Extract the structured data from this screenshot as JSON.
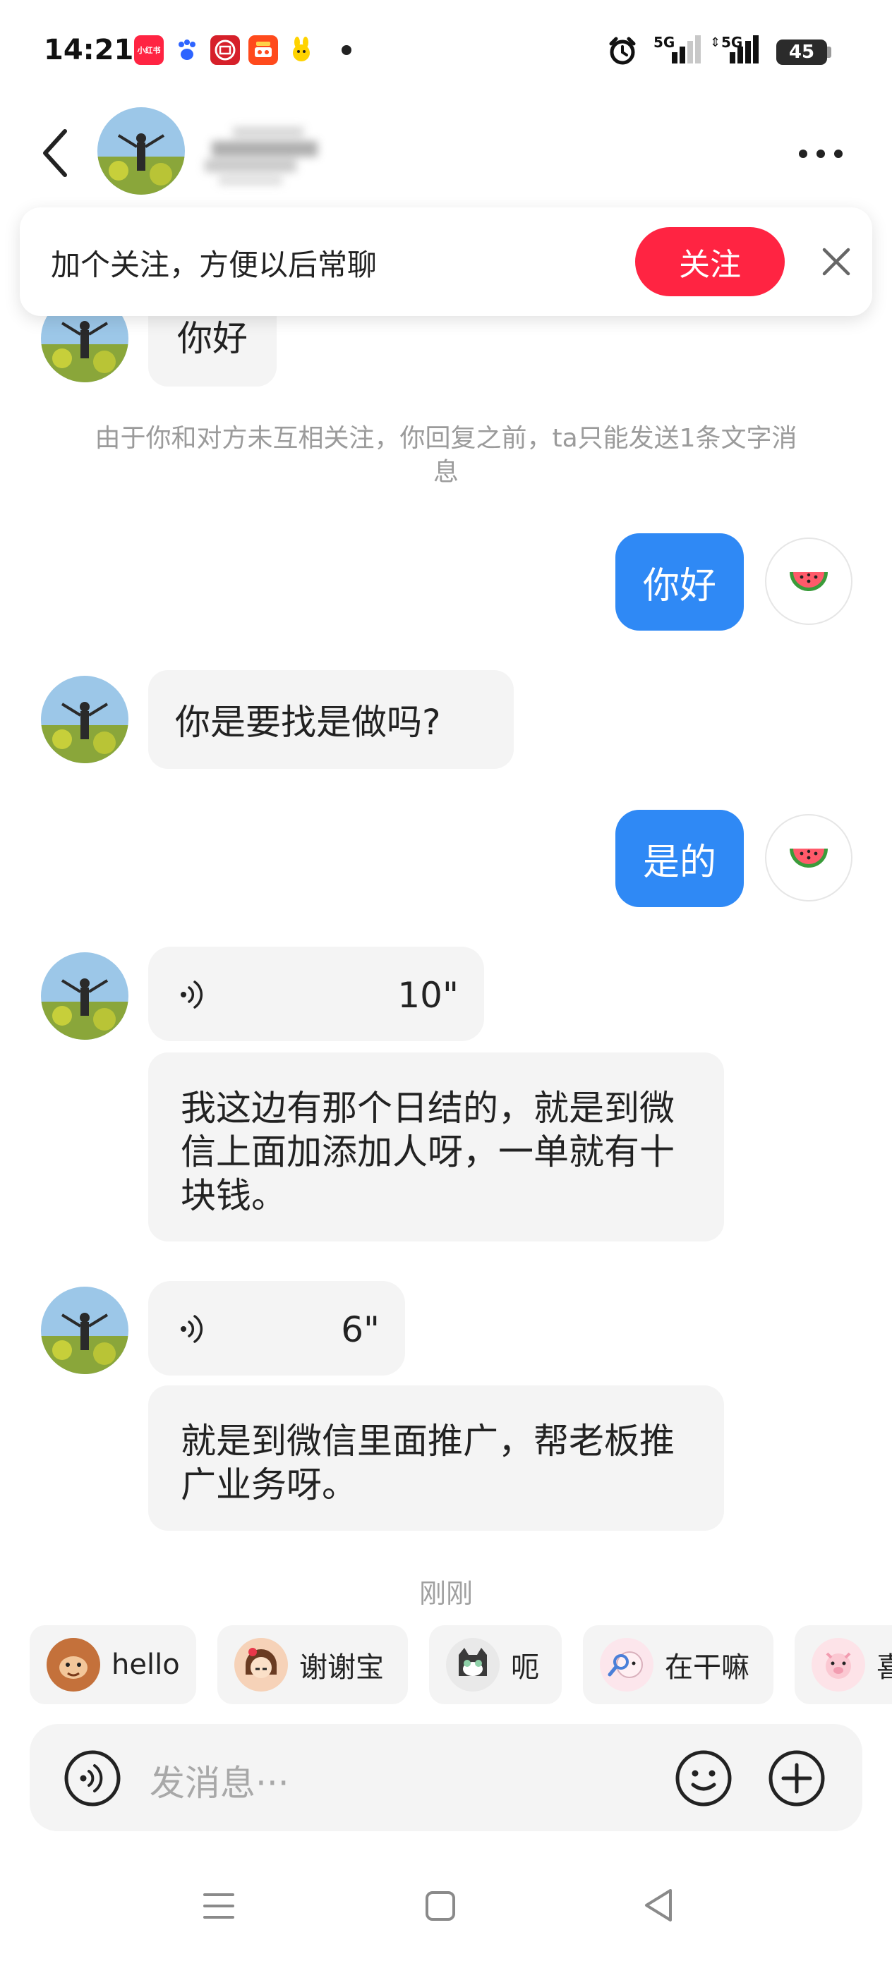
{
  "status_bar": {
    "time": "14:21",
    "apps": [
      "小红书",
      "百度",
      "铁路",
      "外卖",
      "闲鱼"
    ],
    "network_1": "5G",
    "network_2": "5G",
    "battery": "45"
  },
  "header": {
    "back_icon": "chevron-left-icon",
    "more_icon": "more-horizontal-icon"
  },
  "follow_banner": {
    "text": "加个关注，方便以后常聊",
    "button": "关注",
    "close_icon": "close-icon"
  },
  "messages": {
    "m1": "你好",
    "system_note": "由于你和对方未互相关注，你回复之前，ta只能发送1条文字消息",
    "m2": "你好",
    "m3": "你是要找是做吗?",
    "m4": "是的",
    "voice1_duration": "10\"",
    "m5": "我这边有那个日结的，就是到微信上面加添加人呀，一单就有十块钱。",
    "voice2_duration": "6\"",
    "m6": "就是到微信里面推广，帮老板推广业务呀。",
    "timestamp": "刚刚"
  },
  "quick_replies": [
    {
      "label": "hello",
      "emoji": "monkey-emoji"
    },
    {
      "label": "谢谢宝",
      "emoji": "girl-emoji"
    },
    {
      "label": "呃",
      "emoji": "cat-emoji"
    },
    {
      "label": "在干嘛",
      "emoji": "search-emoji"
    },
    {
      "label": "喜",
      "emoji": "pig-emoji"
    }
  ],
  "input": {
    "placeholder": "发消息···"
  },
  "colors": {
    "accent_red": "#ff2442",
    "bubble_blue": "#2f89f5",
    "bubble_gray": "#f4f4f4"
  }
}
